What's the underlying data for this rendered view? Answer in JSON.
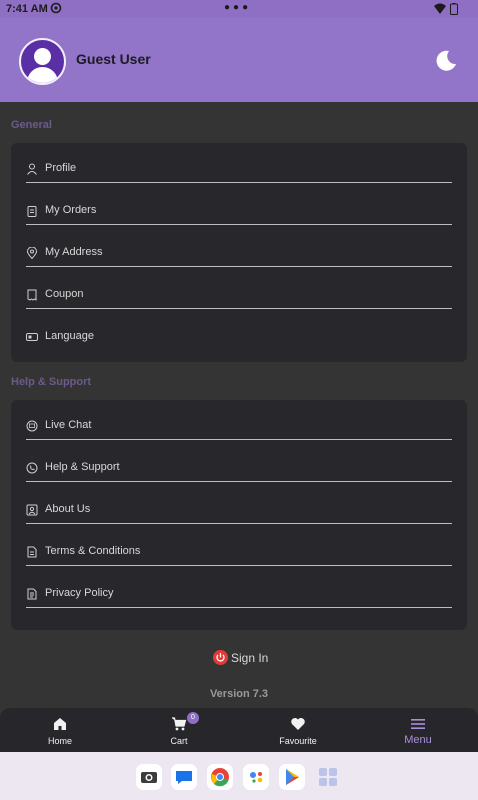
{
  "status_bar": {
    "time": "7:41 AM"
  },
  "header": {
    "user_name": "Guest User"
  },
  "sections": {
    "general": {
      "title": "General",
      "items": [
        {
          "label": "Profile",
          "icon": "person-icon"
        },
        {
          "label": "My Orders",
          "icon": "clipboard-icon"
        },
        {
          "label": "My Address",
          "icon": "location-pin-icon"
        },
        {
          "label": "Coupon",
          "icon": "coupon-icon"
        },
        {
          "label": "Language",
          "icon": "language-icon"
        }
      ]
    },
    "help": {
      "title": "Help & Support",
      "items": [
        {
          "label": "Live Chat",
          "icon": "chat-icon"
        },
        {
          "label": "Help & Support",
          "icon": "phone-icon"
        },
        {
          "label": "About Us",
          "icon": "about-icon"
        },
        {
          "label": "Terms & Conditions",
          "icon": "document-icon"
        },
        {
          "label": "Privacy Policy",
          "icon": "policy-icon"
        }
      ]
    }
  },
  "sign_in": {
    "label": "Sign In"
  },
  "version": {
    "text": "Version 7.3"
  },
  "bottom_nav": {
    "items": [
      {
        "label": "Home",
        "icon": "home-icon"
      },
      {
        "label": "Cart",
        "icon": "cart-icon",
        "badge": "0"
      },
      {
        "label": "Favourite",
        "icon": "heart-icon"
      },
      {
        "label": "Menu",
        "icon": "menu-icon",
        "active": true
      }
    ]
  },
  "colors": {
    "accent": "#9274c9",
    "background": "#343434",
    "card": "#28282c",
    "signin_red": "#e23b36"
  },
  "system_dock": {
    "apps": [
      "camera-icon",
      "messages-icon",
      "chrome-icon",
      "assistant-icon",
      "play-store-icon",
      "apps-grid-icon"
    ]
  }
}
